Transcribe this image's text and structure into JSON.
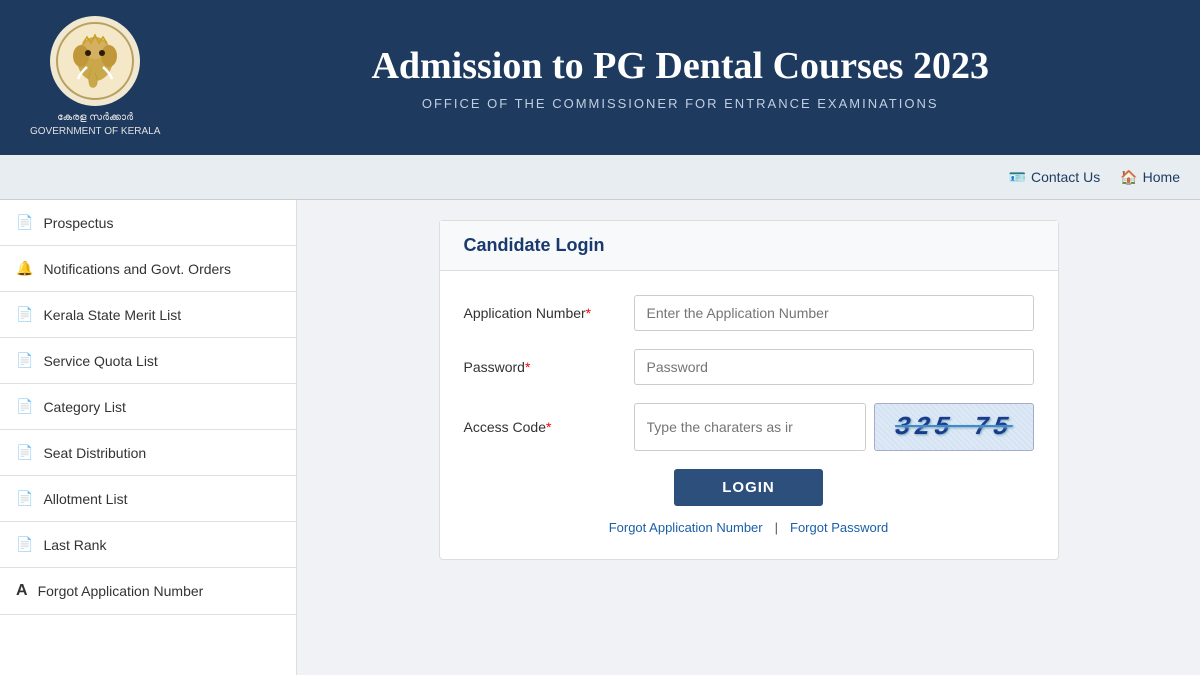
{
  "header": {
    "title": "Admission to PG Dental Courses 2023",
    "subtitle": "OFFICE OF THE COMMISSIONER FOR ENTRANCE EXAMINATIONS",
    "logo_line1": "കേരള സർക്കാർ",
    "logo_line2": "GOVERNMENT OF KERALA"
  },
  "navbar": {
    "contact_label": "Contact Us",
    "home_label": "Home"
  },
  "sidebar": {
    "items": [
      {
        "label": "Prospectus",
        "icon": "📄"
      },
      {
        "label": "Notifications and Govt. Orders",
        "icon": "🔔"
      },
      {
        "label": "Kerala State Merit List",
        "icon": "📄"
      },
      {
        "label": "Service Quota List",
        "icon": "📄"
      },
      {
        "label": "Category List",
        "icon": "📄"
      },
      {
        "label": "Seat Distribution",
        "icon": "📄"
      },
      {
        "label": "Allotment List",
        "icon": "📄"
      },
      {
        "label": "Last Rank",
        "icon": "📄"
      },
      {
        "label": "Forgot Application Number",
        "icon": "🅐"
      }
    ]
  },
  "login": {
    "title": "Candidate Login",
    "app_number_label": "Application Number",
    "app_number_placeholder": "Enter the Application Number",
    "password_label": "Password",
    "password_placeholder": "Password",
    "access_code_label": "Access Code",
    "access_code_placeholder": "Type the charaters as ir",
    "captcha_text": "325 75",
    "login_button": "LOGIN",
    "forgot_app": "Forgot Application Number",
    "forgot_divider": "|",
    "forgot_password": "Forgot Password"
  }
}
